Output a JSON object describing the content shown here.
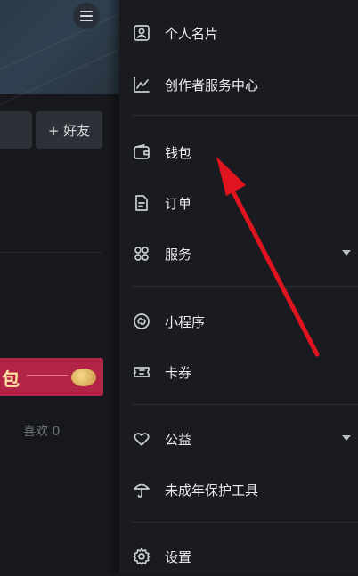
{
  "profile": {
    "add_friend_label": "+ 好友",
    "promo_text": "包",
    "likes_text": "喜欢 0"
  },
  "drawer": {
    "items": [
      {
        "label": "个人名片",
        "icon": "profile-card-icon"
      },
      {
        "label": "创作者服务中心",
        "icon": "trend-chart-icon"
      },
      {
        "label": "钱包",
        "icon": "wallet-icon"
      },
      {
        "label": "订单",
        "icon": "order-document-icon"
      },
      {
        "label": "服务",
        "icon": "grid-apps-icon",
        "expandable": true
      },
      {
        "label": "小程序",
        "icon": "mini-program-link-icon"
      },
      {
        "label": "卡券",
        "icon": "coupon-ticket-icon"
      },
      {
        "label": "公益",
        "icon": "heart-icon",
        "expandable": true
      },
      {
        "label": "未成年保护工具",
        "icon": "umbrella-icon"
      },
      {
        "label": "设置",
        "icon": "gear-icon"
      }
    ]
  },
  "colors": {
    "drawer_bg": "#191b21",
    "annotation_arrow": "#e0141e",
    "promo_card": "#b22445"
  }
}
